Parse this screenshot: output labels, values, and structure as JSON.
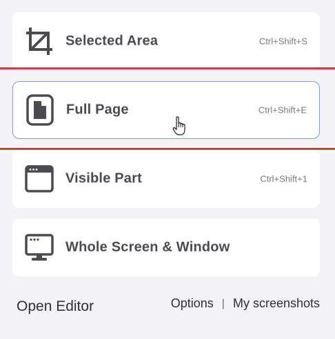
{
  "menu": {
    "items": [
      {
        "label": "Selected Area",
        "shortcut": "Ctrl+Shift+S",
        "icon": "crop-icon"
      },
      {
        "label": "Full Page",
        "shortcut": "Ctrl+Shift+E",
        "icon": "document-icon"
      },
      {
        "label": "Visible Part",
        "shortcut": "Ctrl+Shift+1",
        "icon": "browser-window-icon"
      },
      {
        "label": "Whole Screen & Window",
        "shortcut": "",
        "icon": "monitor-icon"
      }
    ]
  },
  "footer": {
    "open_editor": "Open Editor",
    "options": "Options",
    "separator": "|",
    "my_screenshots": "My screenshots"
  },
  "colors": {
    "highlight": "#d9383a",
    "selected_border": "#7d9bd8",
    "icon": "#4a4a50"
  }
}
